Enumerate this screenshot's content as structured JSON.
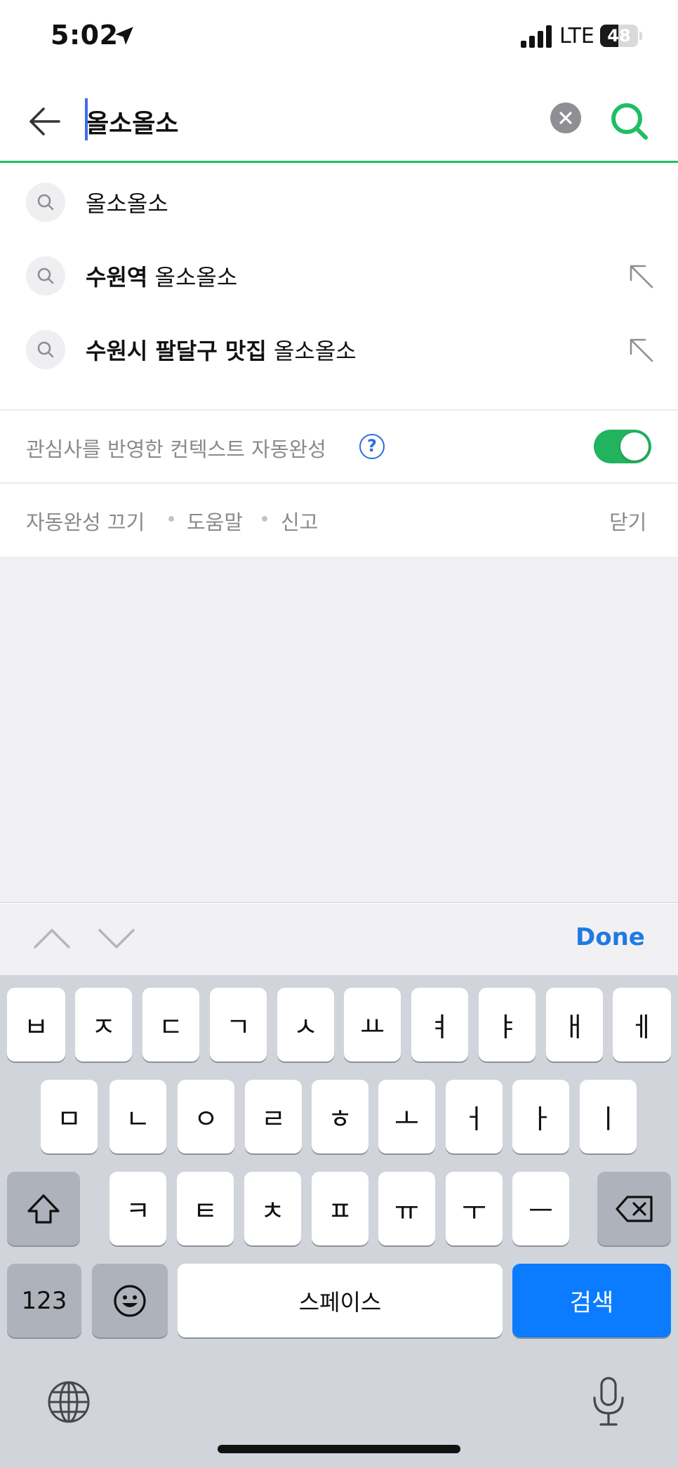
{
  "status_bar": {
    "time": "5:02",
    "network": "LTE",
    "battery_level": "48",
    "battery_fraction": 0.48
  },
  "search": {
    "query": "올소올소",
    "clear_icon": "clear-x-icon",
    "submit_icon": "search-icon",
    "accent_color": "#1fbe62"
  },
  "suggestions": [
    {
      "bold": "",
      "rest": "올소올소",
      "has_arrow": false
    },
    {
      "bold": "수원역",
      "rest": " 올소올소",
      "has_arrow": true
    },
    {
      "bold": "수원시 팔달구 맛집",
      "rest": " 올소올소",
      "has_arrow": true
    }
  ],
  "context": {
    "label": "관심사를 반영한 컨텍스트 자동완성",
    "help_symbol": "?",
    "toggle_on": true,
    "toggle_color": "#21b35d"
  },
  "footer": {
    "autocomplete_off": "자동완성 끄기",
    "help": "도움말",
    "report": "신고",
    "close": "닫기"
  },
  "accessory": {
    "done": "Done"
  },
  "keyboard": {
    "row1": [
      "ㅂ",
      "ㅈ",
      "ㄷ",
      "ㄱ",
      "ㅅ",
      "ㅛ",
      "ㅕ",
      "ㅑ",
      "ㅐ",
      "ㅔ"
    ],
    "row2": [
      "ㅁ",
      "ㄴ",
      "ㅇ",
      "ㄹ",
      "ㅎ",
      "ㅗ",
      "ㅓ",
      "ㅏ",
      "ㅣ"
    ],
    "row3": [
      "ㅋ",
      "ㅌ",
      "ㅊ",
      "ㅍ",
      "ㅠ",
      "ㅜ",
      "ㅡ"
    ],
    "numbers": "123",
    "space": "스페이스",
    "search": "검색"
  }
}
